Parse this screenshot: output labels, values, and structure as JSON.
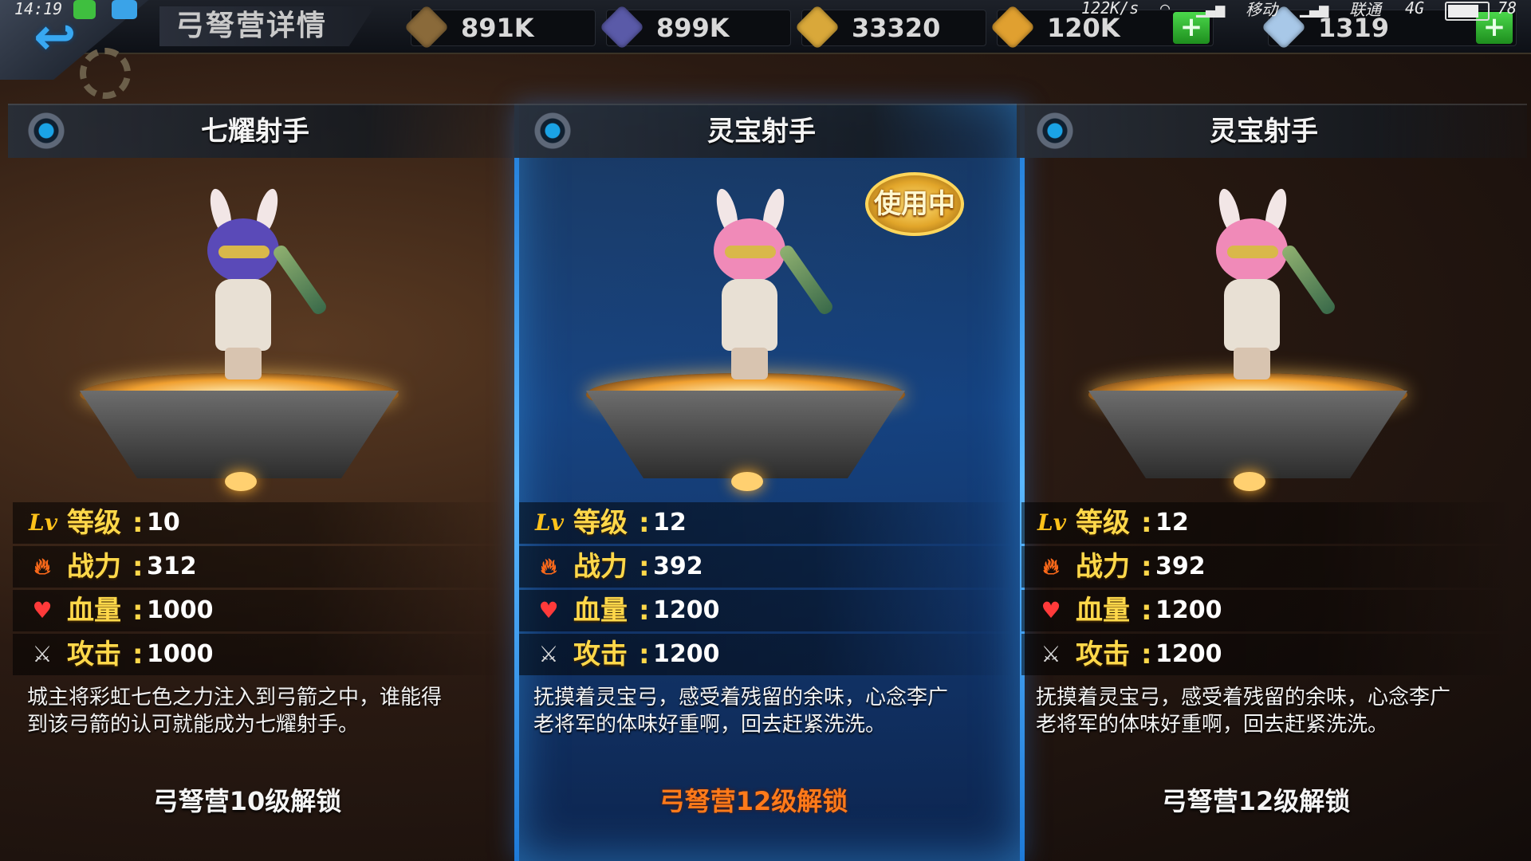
{
  "status_bar": {
    "time": "14:19",
    "speed": "122K/s",
    "carrier1": "移动",
    "carrier2": "联通",
    "network": "4G",
    "battery": "78"
  },
  "header": {
    "title": "弓弩营详情",
    "currencies": [
      {
        "icon": "wood-icon",
        "value": "891K",
        "color": "#8a6a3a"
      },
      {
        "icon": "crystal-icon",
        "value": "899K",
        "color": "#5a5aa8"
      },
      {
        "icon": "gold-cube-icon",
        "value": "33320",
        "color": "#d9a83a"
      },
      {
        "icon": "orange-cube-icon",
        "value": "120K",
        "color": "#e0a030"
      },
      {
        "icon": "diamond-icon",
        "value": "1319",
        "color": "#a8c8e8"
      }
    ]
  },
  "cards": [
    {
      "name": "七耀射手",
      "in_use": false,
      "stats": {
        "level_label": "等级",
        "level": "10",
        "power_label": "战力",
        "power": "312",
        "hp_label": "血量",
        "hp": "1000",
        "attack_label": "攻击",
        "attack": "1000"
      },
      "description": "城主将彩虹七色之力注入到弓箭之中，谁能得到该弓箭的认可就能成为七耀射手。",
      "unlock": "弓弩营10级解锁",
      "hair_color": "#5a4ab8"
    },
    {
      "name": "灵宝射手",
      "in_use": true,
      "in_use_label": "使用中",
      "stats": {
        "level_label": "等级",
        "level": "12",
        "power_label": "战力",
        "power": "392",
        "hp_label": "血量",
        "hp": "1200",
        "attack_label": "攻击",
        "attack": "1200"
      },
      "description": "抚摸着灵宝弓，感受着残留的余味，心念李广老将军的体味好重啊，回去赶紧洗洗。",
      "unlock": "弓弩营12级解锁",
      "hair_color": "#f08ab8"
    },
    {
      "name": "灵宝射手",
      "in_use": false,
      "stats": {
        "level_label": "等级",
        "level": "12",
        "power_label": "战力",
        "power": "392",
        "hp_label": "血量",
        "hp": "1200",
        "attack_label": "攻击",
        "attack": "1200"
      },
      "description": "抚摸着灵宝弓，感受着残留的余味，心念李广老将军的体味好重啊，回去赶紧洗洗。",
      "unlock": "弓弩营12级解锁",
      "hair_color": "#f08ab8"
    }
  ]
}
